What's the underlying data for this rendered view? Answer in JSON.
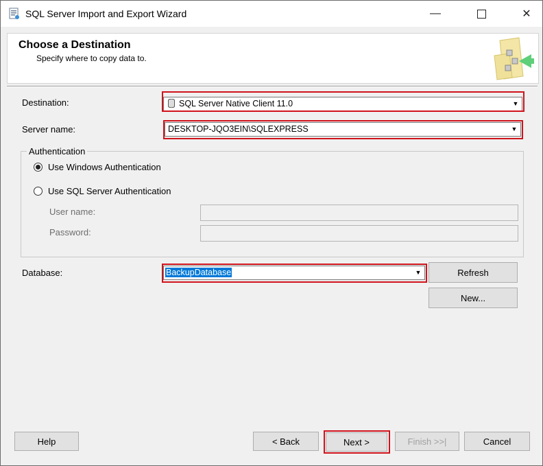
{
  "window": {
    "title": "SQL Server Import and Export Wizard"
  },
  "header": {
    "title": "Choose a Destination",
    "subtitle": "Specify where to copy data to."
  },
  "destination": {
    "label": "Destination:",
    "value": "SQL Server Native Client 11.0"
  },
  "server": {
    "label": "Server name:",
    "value": "DESKTOP-JQO3EIN\\SQLEXPRESS"
  },
  "authentication": {
    "legend": "Authentication",
    "windows_label": "Use Windows Authentication",
    "sql_label": "Use SQL Server Authentication",
    "selected": "windows",
    "username_label": "User name:",
    "password_label": "Password:"
  },
  "database": {
    "label": "Database:",
    "value": "BackupDatabase"
  },
  "buttons": {
    "refresh": "Refresh",
    "new": "New...",
    "help": "Help",
    "back": "< Back",
    "next": "Next >",
    "finish": "Finish >>|",
    "cancel": "Cancel"
  },
  "colors": {
    "highlight": "#d0121b",
    "selection": "#0078d7"
  }
}
